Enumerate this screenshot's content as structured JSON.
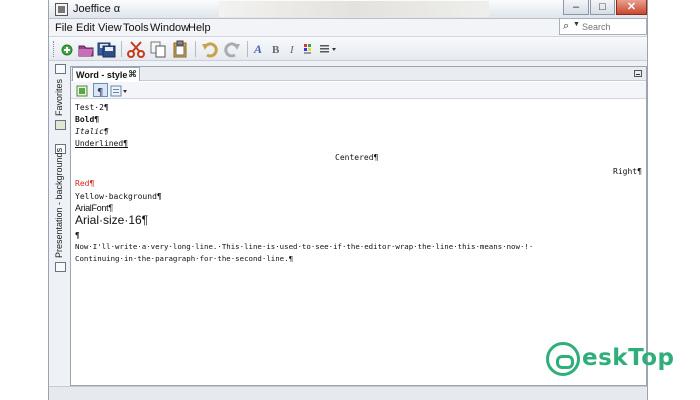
{
  "window": {
    "title": "Joeffice α"
  },
  "menubar": {
    "items": [
      "File",
      "Edit",
      "View",
      "Tools",
      "Window",
      "Help"
    ]
  },
  "search": {
    "placeholder": "Search"
  },
  "window_controls": {
    "minimize": "–",
    "maximize": "□",
    "close": "✕"
  },
  "sidebar": {
    "labels": [
      "Favorites",
      "Presentation - backgrounds"
    ]
  },
  "tab": {
    "label": "Word - style",
    "close": "⌘"
  },
  "document": {
    "lines": [
      {
        "text": "Test·2¶",
        "style": "normal"
      },
      {
        "text": "Bold¶",
        "style": "bold"
      },
      {
        "text": "Italic¶",
        "style": "italic"
      },
      {
        "text": "Underlined¶",
        "style": "underline"
      },
      {
        "text": "Centered¶",
        "style": "center"
      },
      {
        "text": "Right¶",
        "style": "right"
      },
      {
        "text": "Red¶",
        "style": "red"
      },
      {
        "text": "Yellow·background¶",
        "style": "yellow"
      },
      {
        "text": "ArialFont¶",
        "style": "arial"
      },
      {
        "text": "Arial·size·16¶",
        "style": "arial16"
      },
      {
        "text": "¶",
        "style": "normal"
      },
      {
        "text": "Now·I'll·write·a·very·long·line.·This·line·is·used·to·see·if·the·editor·wrap·the·line·this·means·now·!·",
        "style": "normal"
      },
      {
        "text": "Continuing·in·the·paragraph·for·the·second·line.¶",
        "style": "normal"
      }
    ]
  },
  "colors": {
    "red_text": "#d9261c",
    "watermark": "#2fae7a"
  },
  "watermark": {
    "text": "eskTop"
  }
}
